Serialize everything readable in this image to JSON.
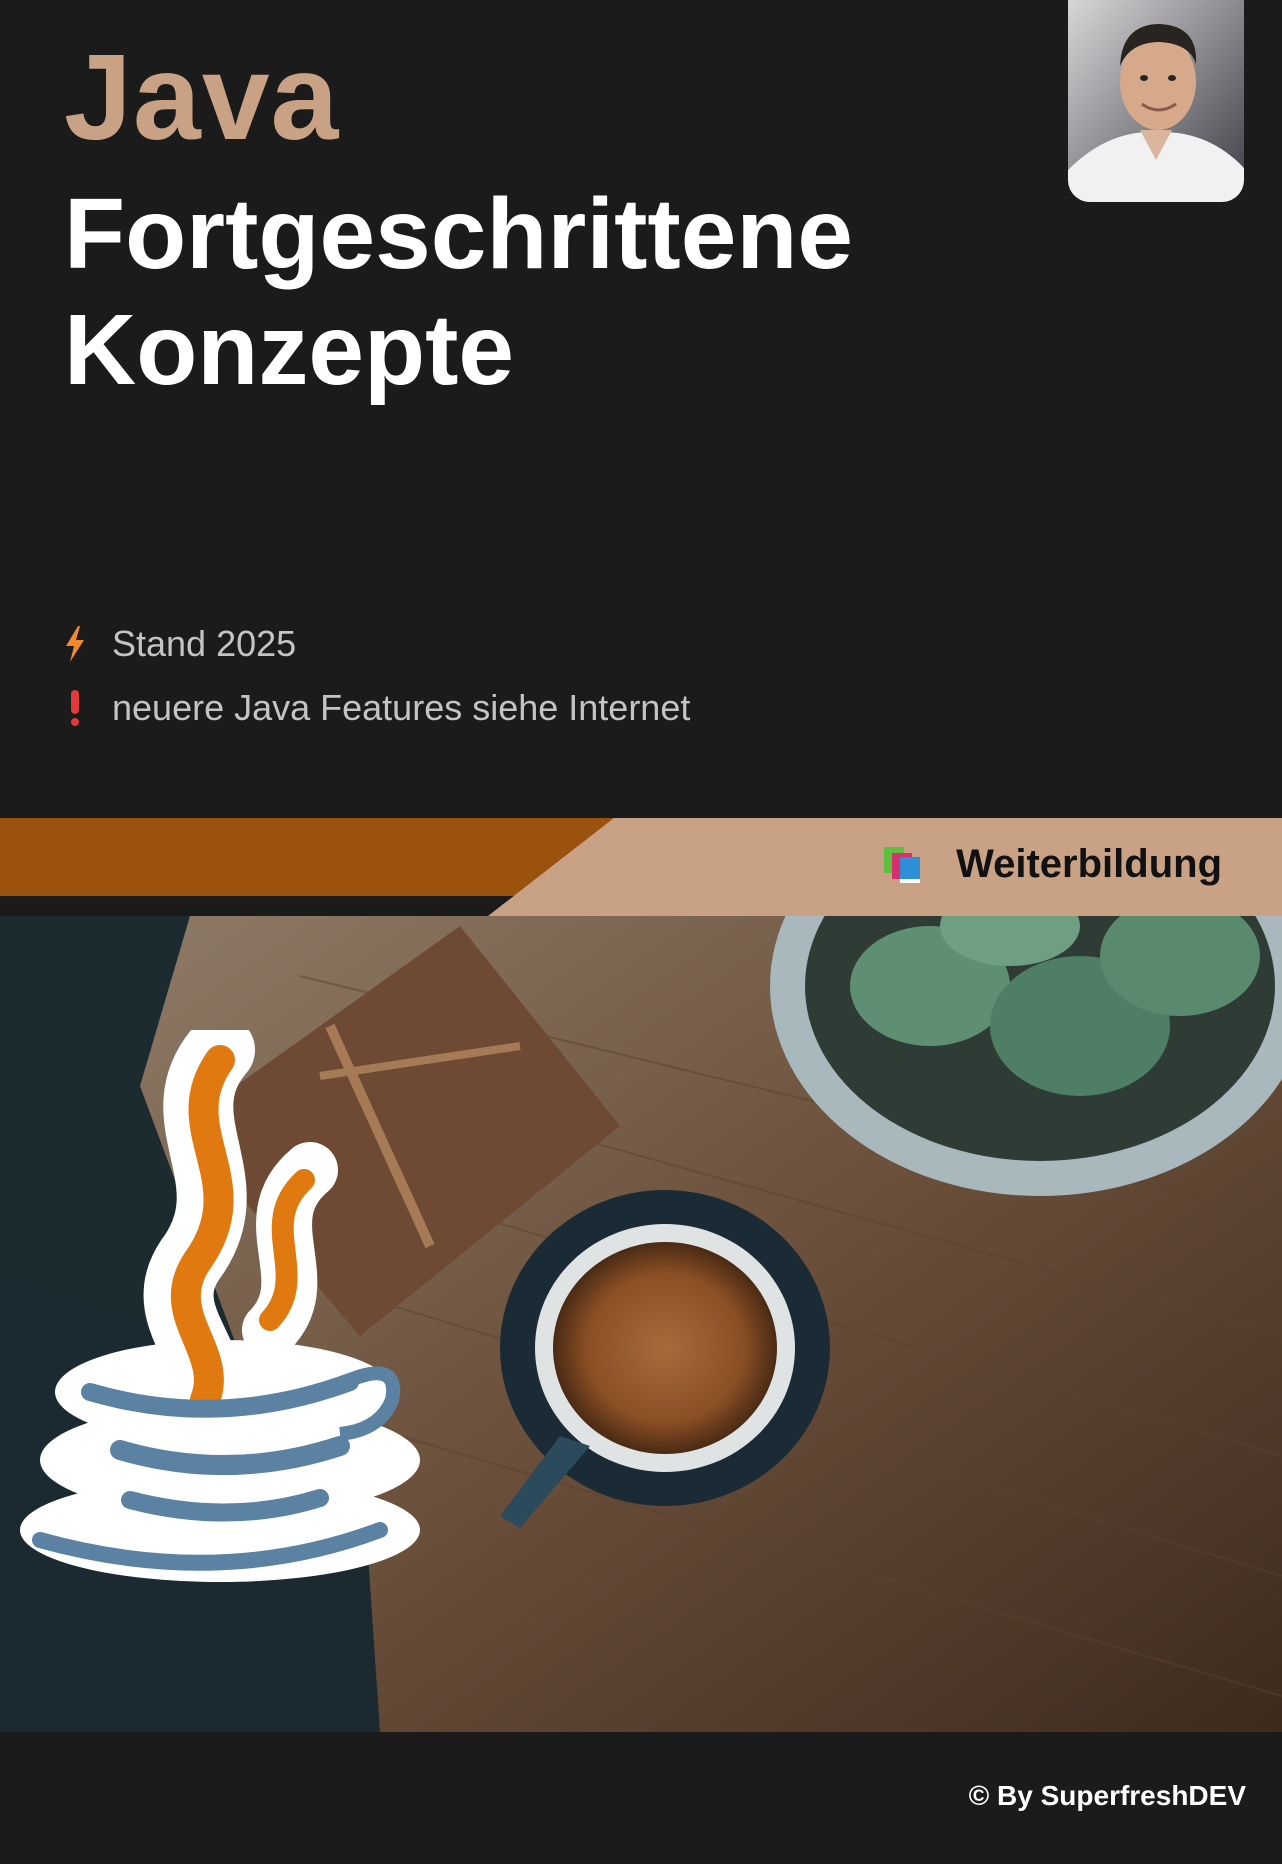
{
  "title": {
    "line1": "Java",
    "line2": "Fortgeschrittene",
    "line3": "Konzepte"
  },
  "info": [
    {
      "icon": "lightning-icon",
      "text": "Stand 2025",
      "color": "#f08a2b"
    },
    {
      "icon": "exclamation-icon",
      "text": "neuere Java Features siehe Internet",
      "color": "#e23a3a"
    }
  ],
  "banner": {
    "label": "Weiterbildung",
    "icon": "books-icon",
    "colors": {
      "dark": "#9b520f",
      "light": "#c9a285"
    }
  },
  "footer": {
    "copyright": "© By SuperfreshDEV"
  },
  "colors": {
    "background": "#1b1b1b",
    "accent": "#c9a285"
  }
}
